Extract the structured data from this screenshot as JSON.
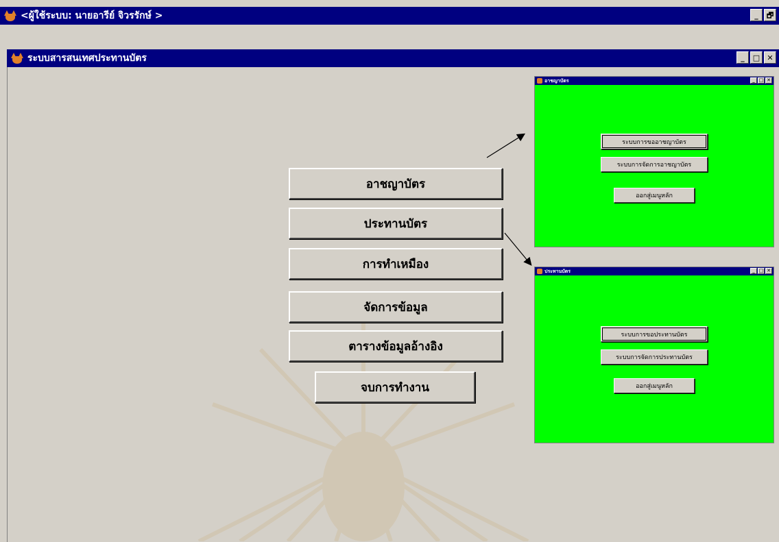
{
  "app_window": {
    "title": "<ผู้ใช้ระบบ:  นายอารีย์  จิวรรักษ์ >",
    "buttons": [
      "_",
      "🗗"
    ]
  },
  "main_window": {
    "title": "ระบบสารสนเทศประทานบัตร",
    "buttons": [
      "_",
      "□",
      "✕"
    ]
  },
  "menu_buttons": [
    "อาชญาบัตร",
    "ประทานบัตร",
    "การทำเหมือง",
    "จัดการข้อมูล",
    "ตารางข้อมูลอ้างอิง",
    "จบการทำงาน"
  ],
  "child_windows": [
    {
      "title": "อาชญาบัตร",
      "buttons": [
        "ระบบการขออาชญาบัตร",
        "ระบบการจัดการอาชญาบัตร",
        "ออกสู่เมนูหลัก"
      ]
    },
    {
      "title": "ประทานบัตร",
      "buttons": [
        "ระบบการขอประทานบัตร",
        "ระบบการจัดการประทานบัตร",
        "ออกสู่เมนูหลัก"
      ]
    }
  ],
  "colors": {
    "titlebar": "#000080",
    "child_background": "#00ff00",
    "window_face": "#d4d0c8"
  }
}
